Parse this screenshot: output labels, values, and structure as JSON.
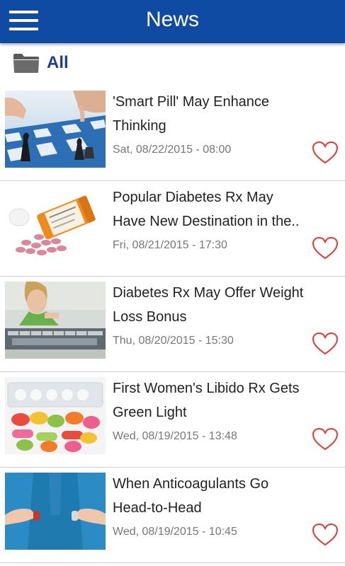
{
  "header": {
    "title": "News",
    "menu_icon": "hamburger-menu-icon",
    "color": "#0f4aa3"
  },
  "category": {
    "icon": "folder-icon",
    "label": "All",
    "color": "#1d3f98"
  },
  "articles": [
    {
      "title": "'Smart Pill' May Enhance Thinking",
      "date": "Sat, 08/22/2015 - 08:00",
      "image": "chess-hands-image",
      "favorite_icon": "heart-outline-icon"
    },
    {
      "title": "Popular Diabetes Rx May Have New Destination in the..",
      "date": "Fri, 08/21/2015 - 17:30",
      "image": "pill-bottle-image",
      "favorite_icon": "heart-outline-icon"
    },
    {
      "title": "Diabetes Rx May Offer Weight Loss Bonus",
      "date": "Thu, 08/20/2015 - 15:30",
      "image": "woman-on-scale-image",
      "favorite_icon": "heart-outline-icon"
    },
    {
      "title": "First Women's Libido Rx Gets Green Light",
      "date": "Wed, 08/19/2015 - 13:48",
      "image": "colorful-pills-image",
      "favorite_icon": "heart-outline-icon"
    },
    {
      "title": "When Anticoagulants Go Head-to-Head",
      "date": "Wed, 08/19/2015 - 10:45",
      "image": "hands-holding-pills-image",
      "favorite_icon": "heart-outline-icon"
    }
  ],
  "colors": {
    "heart": "#e53935",
    "date_text": "#777777",
    "headline_text": "#222222"
  }
}
